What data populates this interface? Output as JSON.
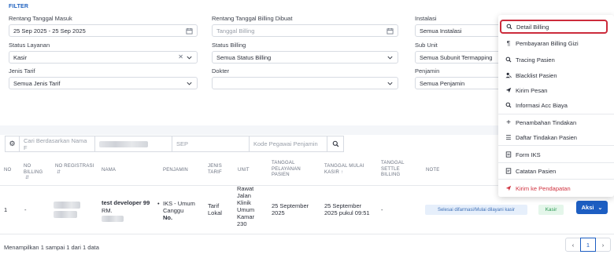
{
  "filter": {
    "title": "FILTER",
    "fields": {
      "tanggal_masuk": {
        "label": "Rentang Tanggal Masuk",
        "value": "25 Sep 2025 - 25 Sep 2025"
      },
      "tanggal_billing": {
        "label": "Rentang Tanggal Billing Dibuat",
        "placeholder": "Tanggal Billing"
      },
      "instalasi": {
        "label": "Instalasi",
        "value": "Semua Instalasi"
      },
      "status_layanan": {
        "label": "Status Layanan",
        "value": "Kasir"
      },
      "status_billing": {
        "label": "Status Billing",
        "value": "Semua Status Billing"
      },
      "sub_unit": {
        "label": "Sub Unit",
        "value": "Semua Subunit Termapping"
      },
      "jenis_tarif": {
        "label": "Jenis Tarif",
        "value": "Semua Jenis Tarif"
      },
      "dokter": {
        "label": "Dokter",
        "value": ""
      },
      "penjamin": {
        "label": "Penjamin",
        "value": "Semua Penjamin"
      }
    }
  },
  "search": {
    "name_placeholder": "Cari Berdasarkan Nama F",
    "sep_placeholder": "SEP",
    "kode_pegawai_placeholder": "Kode Pegawai Penjamin"
  },
  "table": {
    "headers": {
      "no": "NO",
      "no_billing": "NO BILLING",
      "no_registrasi": "NO REGISTRASI",
      "nama": "NAMA",
      "penjamin": "PENJAMIN",
      "jenis_tarif": "JENIS TARIF",
      "unit": "UNIT",
      "tanggal_pelayanan": "TANGGAL PELAYANAN PASIEN",
      "tanggal_mulai_kasir": "TANGGAL MULAI KASIR",
      "tanggal_settle": "TANGGAL SETTLE BILLING",
      "note": "NOTE"
    },
    "rows": [
      {
        "no": "1",
        "no_billing": "-",
        "nama_line1": "test developer 99",
        "nama_line2": "RM.",
        "penjamin_line1": "IKS - Umum",
        "penjamin_line2": "Canggu",
        "penjamin_line3": "No.",
        "jenis_tarif_line1": "Tarif",
        "jenis_tarif_line2": "Lokal",
        "unit_lines": [
          "Rawat",
          "Jalan",
          "Klinik",
          "Umum",
          "Kamar",
          "230"
        ],
        "tanggal_pelayanan_line1": "25 September",
        "tanggal_pelayanan_line2": "2025",
        "tanggal_mulai_kasir_line1": "25 September",
        "tanggal_mulai_kasir_line2": "2025 pukul 09:51",
        "tanggal_settle": "-",
        "note": "Selesai difarmasi/Mulai dilayani kasir",
        "status": "Kasir",
        "action_label": "Aksi"
      }
    ]
  },
  "footer": {
    "summary": "Menampilkan 1 sampai 1 dari 1 data",
    "current_page": "1",
    "prev": "‹",
    "next": "›"
  },
  "action_menu": {
    "items": [
      {
        "label": "Detail Billing",
        "icon": "search-icon",
        "glyph": "⚲"
      },
      {
        "label": "Pembayaran Billing Gizi",
        "icon": "utensils-icon",
        "glyph": "¶"
      },
      {
        "label": "Tracing Pasien",
        "icon": "search-icon",
        "glyph": "⚲"
      },
      {
        "label": "Blacklist Pasien",
        "icon": "user-block-icon",
        "glyph": "●"
      },
      {
        "label": "Kirim Pesan",
        "icon": "send-icon",
        "glyph": "➤"
      },
      {
        "label": "Informasi Acc Biaya",
        "icon": "search-icon",
        "glyph": "⚲"
      },
      {
        "label": "Penambahan Tindakan",
        "icon": "plus-icon",
        "glyph": "+"
      },
      {
        "label": "Daftar Tindakan Pasien",
        "icon": "list-icon",
        "glyph": "☰"
      },
      {
        "label": "Form IKS",
        "icon": "file-icon",
        "glyph": "▤"
      },
      {
        "label": "Catatan Pasien",
        "icon": "notes-icon",
        "glyph": "▤"
      },
      {
        "label": "Kirim ke Pendapatan",
        "icon": "send-icon",
        "glyph": "➤"
      }
    ]
  },
  "colors": {
    "primary": "#1d5ec2",
    "highlight_border": "#cc2b3b",
    "danger": "#d0323f",
    "badge_note_bg": "#e6effb",
    "badge_kasir_bg": "#e4f6ea"
  }
}
